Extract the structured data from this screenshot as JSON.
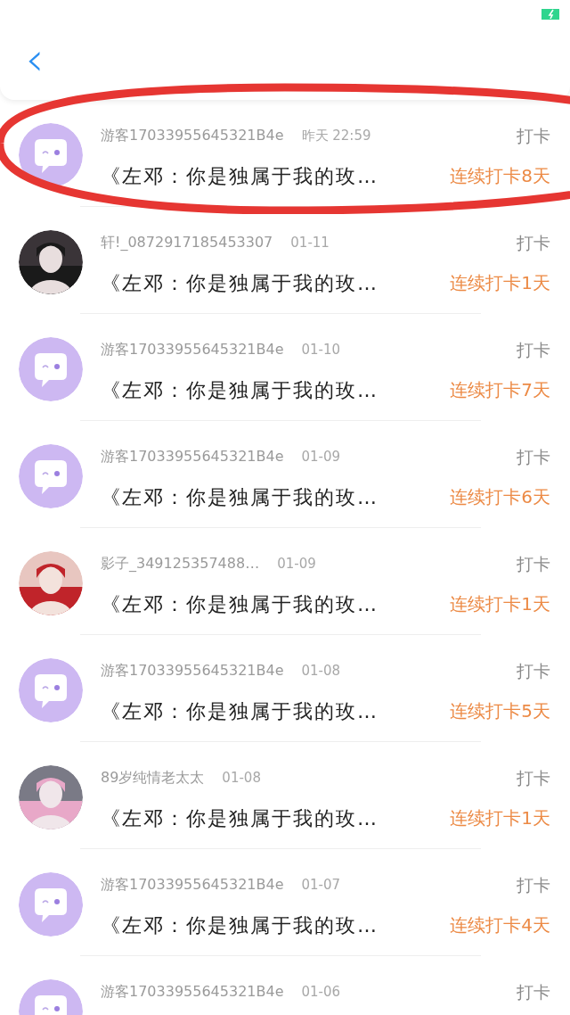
{
  "header": {
    "back": "‹"
  },
  "rows": [
    {
      "kind": "default",
      "name": "游客17033955645321B4e",
      "time": "昨天 22:59",
      "action": "打卡",
      "message": "《左邓：你是独属于我的玫…",
      "streak": "连续打卡8天",
      "highlighted": true
    },
    {
      "kind": "picture",
      "name": "轩!_0872917185453307",
      "time": "01-11",
      "action": "打卡",
      "message": "《左邓：你是独属于我的玫…",
      "streak": "连续打卡1天",
      "highlighted": false
    },
    {
      "name": "游客17033955645321B4e",
      "time": "01-10",
      "kind": "default",
      "action": "打卡",
      "message": "《左邓：你是独属于我的玫…",
      "streak": "连续打卡7天",
      "highlighted": false
    },
    {
      "kind": "default",
      "name": "游客17033955645321B4e",
      "time": "01-09",
      "action": "打卡",
      "message": "《左邓：你是独属于我的玫…",
      "streak": "连续打卡6天",
      "highlighted": false
    },
    {
      "kind": "picture",
      "name": "影子_349125357488…",
      "time": "01-09",
      "action": "打卡",
      "message": "《左邓：你是独属于我的玫…",
      "streak": "连续打卡1天",
      "highlighted": false
    },
    {
      "kind": "default",
      "name": "游客17033955645321B4e",
      "time": "01-08",
      "action": "打卡",
      "message": "《左邓：你是独属于我的玫…",
      "streak": "连续打卡5天",
      "highlighted": false
    },
    {
      "kind": "picture",
      "name": "89岁纯情老太太",
      "time": "01-08",
      "action": "打卡",
      "message": "《左邓：你是独属于我的玫…",
      "streak": "连续打卡1天",
      "highlighted": false
    },
    {
      "kind": "default",
      "name": "游客17033955645321B4e",
      "time": "01-07",
      "action": "打卡",
      "message": "《左邓：你是独属于我的玫…",
      "streak": "连续打卡4天",
      "highlighted": false
    },
    {
      "kind": "default",
      "name": "游客17033955645321B4e",
      "time": "01-06",
      "action": "打卡",
      "highlighted": false
    }
  ]
}
